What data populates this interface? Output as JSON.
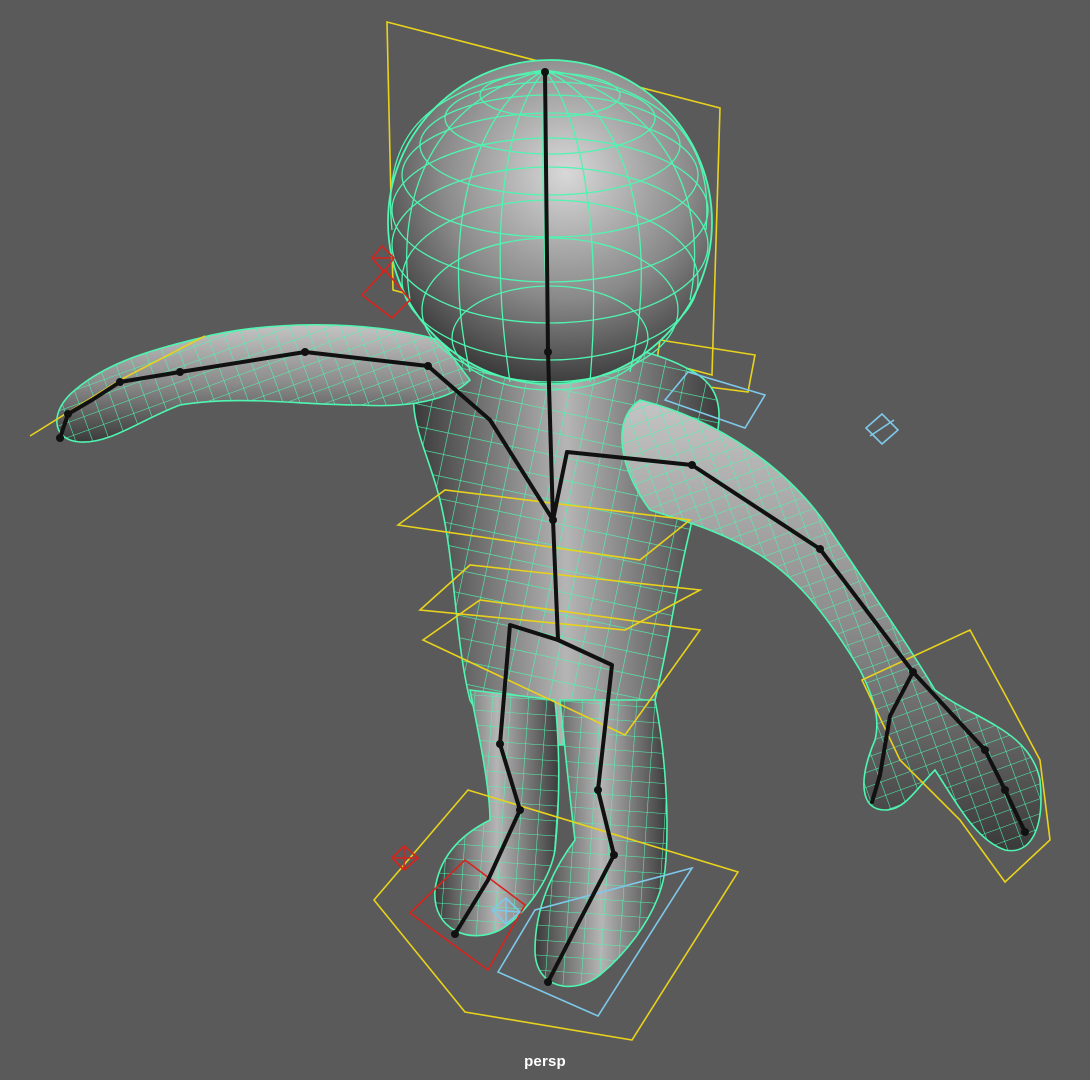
{
  "viewport": {
    "camera_label": "persp",
    "colors": {
      "background": "#5a5a5a",
      "mesh_wire": "#4ff5b0",
      "control_yellow": "#e8d21c",
      "control_red": "#d8231b",
      "control_blue": "#7ec8ea",
      "joint": "#111111"
    }
  }
}
